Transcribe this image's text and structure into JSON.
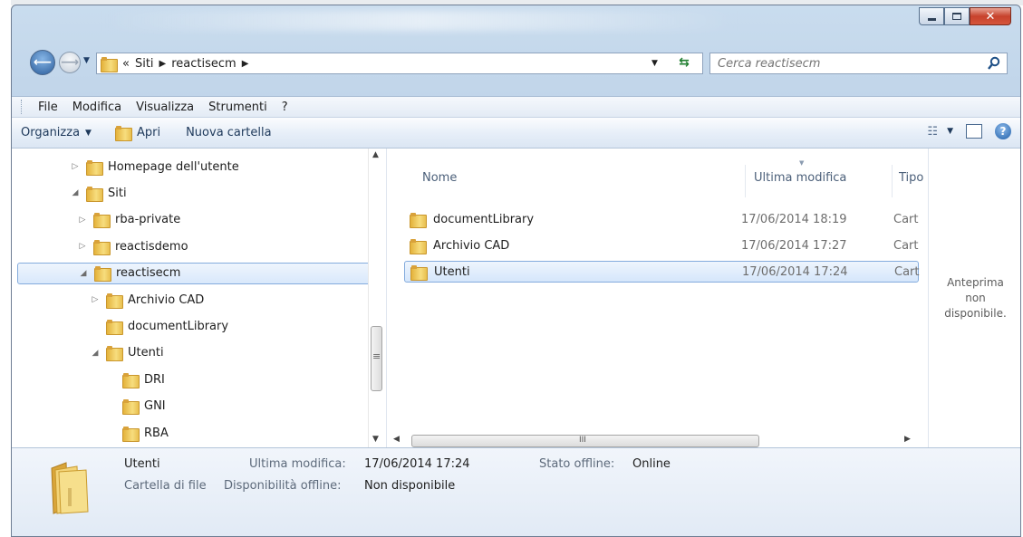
{
  "window": {
    "controls": {
      "minimize": "minimize-icon",
      "maximize": "maximize-icon",
      "close": "close-icon"
    }
  },
  "address": {
    "overflow": "«",
    "crumbs": [
      "Siti",
      "reactisecm"
    ],
    "search_placeholder": "Cerca reactisecm"
  },
  "menu": [
    "File",
    "Modifica",
    "Visualizza",
    "Strumenti",
    "?"
  ],
  "toolbar": {
    "organize": "Organizza",
    "open": "Apri",
    "new_folder": "Nuova cartella"
  },
  "nav_tree": [
    {
      "label": "Homepage dell'utente",
      "arrow": "▷",
      "level": 1
    },
    {
      "label": "Siti",
      "arrow": "◢",
      "level": 1
    },
    {
      "label": "rba-private",
      "arrow": "▷",
      "level": 2
    },
    {
      "label": "reactisdemo",
      "arrow": "▷",
      "level": 2
    },
    {
      "label": "reactisecm",
      "arrow": "◢",
      "level": 2,
      "selected": true
    },
    {
      "label": "Archivio CAD",
      "arrow": "▷",
      "level": 3
    },
    {
      "label": "documentLibrary",
      "arrow": "",
      "level": 3
    },
    {
      "label": "Utenti",
      "arrow": "◢",
      "level": 3
    },
    {
      "label": "DRI",
      "arrow": "",
      "level": 4
    },
    {
      "label": "GNI",
      "arrow": "",
      "level": 4
    },
    {
      "label": "RBA",
      "arrow": "",
      "level": 4
    }
  ],
  "columns": {
    "name": "Nome",
    "modified": "Ultima modifica",
    "type": "Tipo"
  },
  "files": [
    {
      "name": "documentLibrary",
      "modified": "17/06/2014 18:19",
      "type": "Carte"
    },
    {
      "name": "Archivio CAD",
      "modified": "17/06/2014 17:27",
      "type": "Carte"
    },
    {
      "name": "Utenti",
      "modified": "17/06/2014 17:24",
      "type": "Carte",
      "selected": true
    }
  ],
  "preview": {
    "line1": "Anteprima",
    "line2": "non",
    "line3": "disponibile."
  },
  "details": {
    "name": "Utenti",
    "kind": "Cartella di file",
    "modified_label": "Ultima modifica:",
    "modified_value": "17/06/2014 17:24",
    "offline_avail_label": "Disponibilità offline:",
    "offline_avail_value": "Non disponibile",
    "offline_state_label": "Stato offline:",
    "offline_state_value": "Online"
  },
  "scroll_glyph": "III"
}
